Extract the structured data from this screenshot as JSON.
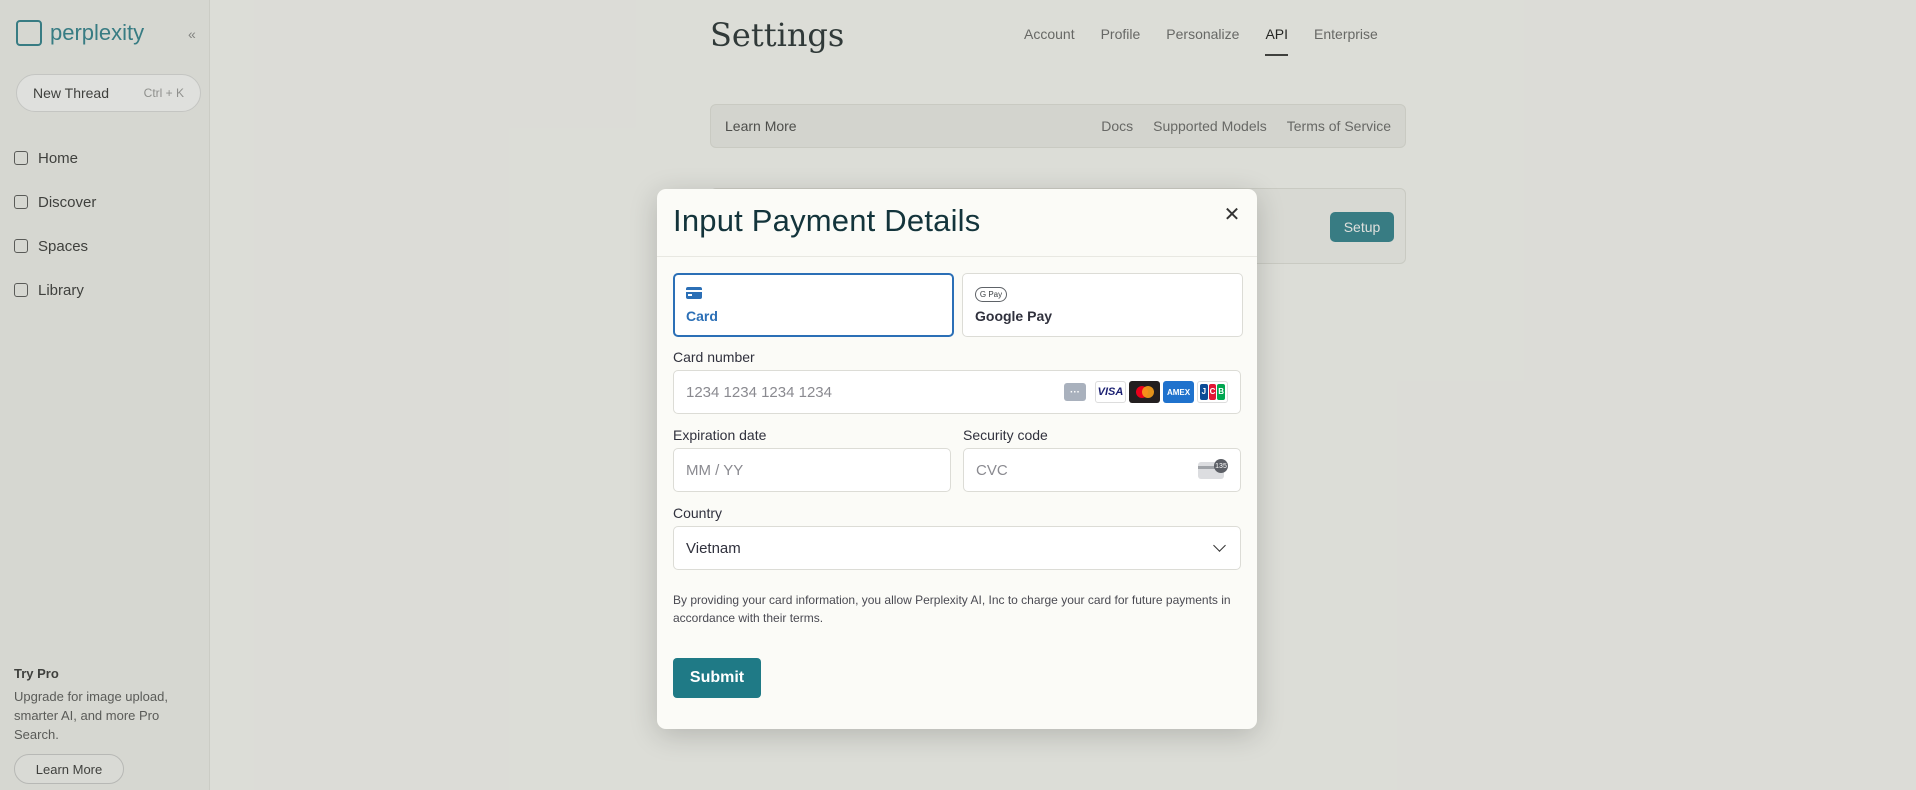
{
  "background": {
    "logo_text": "perplexity",
    "new_thread": {
      "label": "New Thread",
      "shortcut": "Ctrl + K"
    },
    "nav": [
      "Home",
      "Discover",
      "Spaces",
      "Library"
    ],
    "pro": {
      "title": "Try Pro",
      "text": "Upgrade for image upload, smarter AI, and more Pro Search.",
      "button": "Learn More"
    },
    "settings_title": "Settings",
    "settings_tabs": [
      "Account",
      "Profile",
      "Personalize",
      "API",
      "Enterprise"
    ],
    "learn_bar": {
      "label": "Learn More",
      "links": [
        "Docs",
        "Supported Models",
        "Terms of Service"
      ]
    },
    "bg_button": "Setup"
  },
  "modal": {
    "title": "Input Payment Details",
    "tabs": [
      {
        "label": "Card",
        "icon": "credit-card-icon",
        "active": true
      },
      {
        "label": "Google Pay",
        "icon": "google-pay-icon",
        "active": false
      }
    ],
    "card_number": {
      "label": "Card number",
      "placeholder": "1234 1234 1234 1234",
      "brands": [
        "VISA",
        "AMEX"
      ]
    },
    "expiration": {
      "label": "Expiration date",
      "placeholder": "MM / YY"
    },
    "security": {
      "label": "Security code",
      "placeholder": "CVC",
      "icon_text": "135"
    },
    "country": {
      "label": "Country",
      "value": "Vietnam"
    },
    "legal": "By providing your card information, you allow Perplexity AI, Inc to charge your card for future payments in accordance with their terms.",
    "submit": "Submit"
  }
}
